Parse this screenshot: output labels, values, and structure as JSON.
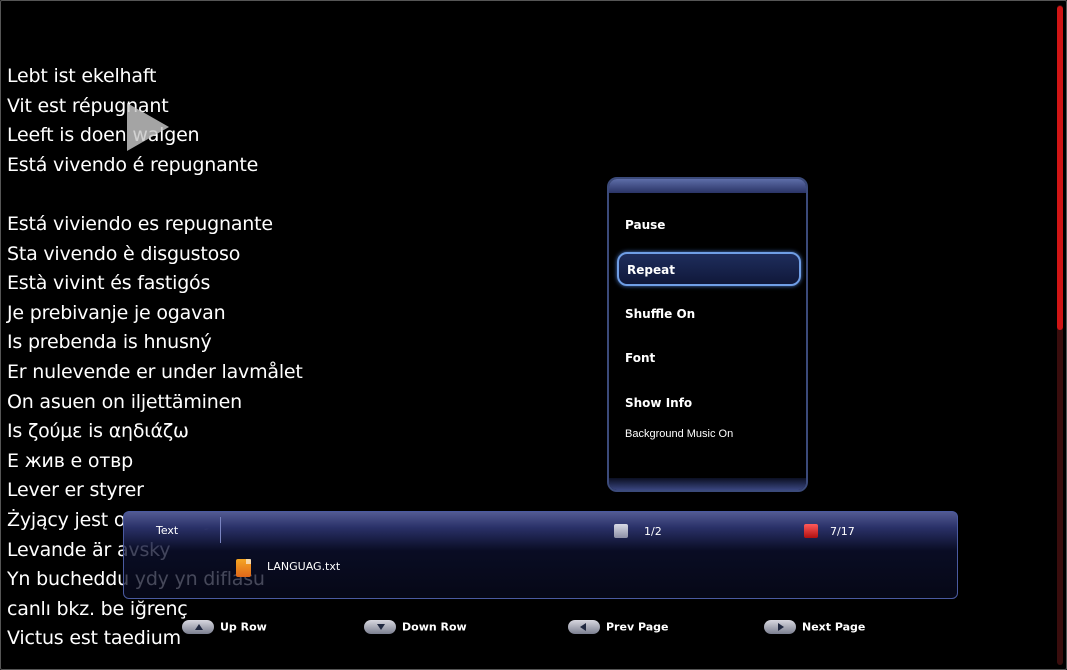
{
  "text_lines": [
    "Lebt ist ekelhaft",
    "Vit est répugnant",
    "Leeft is doen walgen",
    "Está vivendo é repugnante",
    "",
    "Está viviendo es repugnante",
    "Sta vivendo è disgustoso",
    "Està vivint és fastigós",
    "Je prebivanje je ogavan",
    "Is prebenda is hnusný",
    "Er nulevende er under lavmålet",
    "On asuen on iljettäminen",
    "Is ζούμε is αηδιάζω",
    "Е жив е отвр",
    "Lever er styrer",
    "Żyjący jest obrzydliwy",
    "Levande är avsky",
    "Yn bucheddu ydy yn diflasu",
    "canlı bkz. be iğrenç",
    "Victus est taedium"
  ],
  "menu": {
    "items": [
      "Pause",
      "Repeat",
      "Shuffle On",
      "Font",
      "Show Info",
      "Background Music On"
    ],
    "selected_index": 1
  },
  "panel": {
    "type_label": "Text",
    "page_count": "1/2",
    "file_count": "7/17",
    "file_name": "LANGUAG.txt"
  },
  "legend": {
    "up_row": "Up Row",
    "down_row": "Down Row",
    "prev_page": "Prev Page",
    "next_page": "Next Page"
  },
  "scroll": {
    "position": 0.49
  },
  "colors": {
    "accent": "#6f9ee6",
    "scroll": "#d01515",
    "panel": "#2a3168"
  }
}
